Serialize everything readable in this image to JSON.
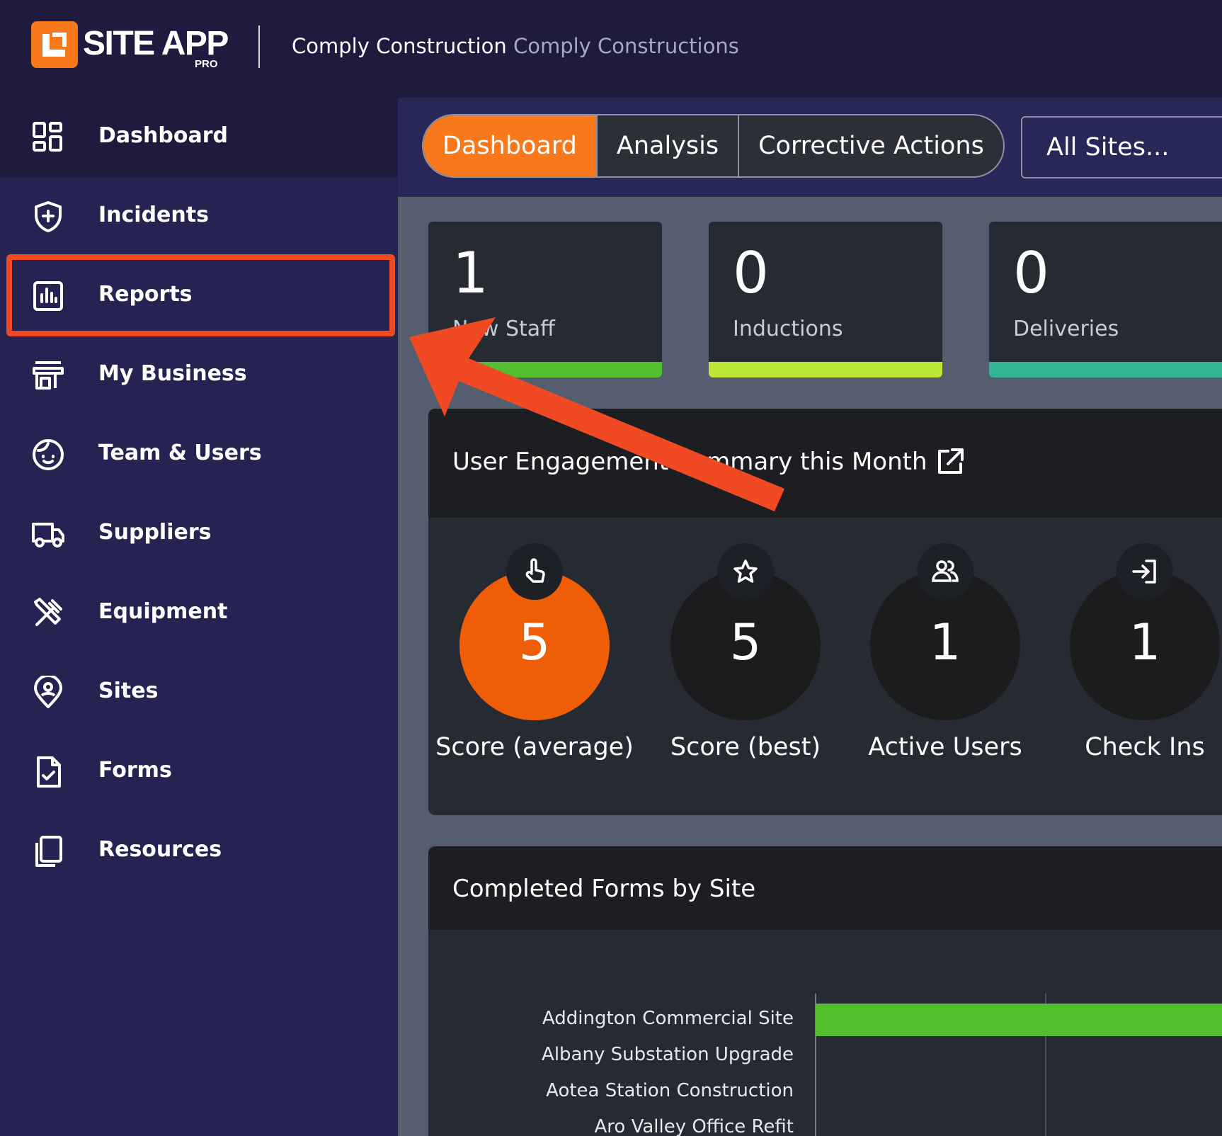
{
  "brand": {
    "name": "SITE APP",
    "tier": "PRO",
    "accent": "#f7791c"
  },
  "company": {
    "name": "Comply Construction",
    "sub": "Comply Constructions"
  },
  "sidebar": {
    "items": [
      {
        "label": "Dashboard",
        "icon": "dashboard-grid-icon",
        "active": true
      },
      {
        "label": "Incidents",
        "icon": "shield-plus-icon"
      },
      {
        "label": "Reports",
        "icon": "report-chart-icon"
      },
      {
        "label": "My Business",
        "icon": "storefront-icon"
      },
      {
        "label": "Team & Users",
        "icon": "face-icon"
      },
      {
        "label": "Suppliers",
        "icon": "truck-icon"
      },
      {
        "label": "Equipment",
        "icon": "tools-icon"
      },
      {
        "label": "Sites",
        "icon": "location-pin-icon"
      },
      {
        "label": "Forms",
        "icon": "form-check-icon"
      },
      {
        "label": "Resources",
        "icon": "copy-documents-icon"
      }
    ]
  },
  "tabs": [
    {
      "label": "Dashboard",
      "active": true
    },
    {
      "label": "Analysis"
    },
    {
      "label": "Corrective Actions"
    }
  ],
  "site_filter": {
    "value": "All Sites..."
  },
  "stats": [
    {
      "value": "1",
      "label": "New Staff",
      "color": "#54be2e"
    },
    {
      "value": "0",
      "label": "Inductions",
      "color": "#bde736"
    },
    {
      "value": "0",
      "label": "Deliveries",
      "color": "#34b594"
    }
  ],
  "engagement": {
    "title": "User Engagement Summary this Month",
    "items": [
      {
        "value": "5",
        "label": "Score (average)",
        "icon": "tap-icon",
        "color": "#f05d07"
      },
      {
        "value": "5",
        "label": "Score (best)",
        "icon": "star-icon"
      },
      {
        "value": "1",
        "label": "Active Users",
        "icon": "users-icon"
      },
      {
        "value": "1",
        "label": "Check Ins",
        "icon": "check-in-icon"
      }
    ]
  },
  "forms_panel": {
    "title": "Completed Forms by Site"
  },
  "chart_data": {
    "type": "bar",
    "orientation": "horizontal",
    "title": "Completed Forms by Site",
    "categories": [
      "Addington Commercial Site",
      "Albany Substation Upgrade",
      "Aotea Station Construction",
      "Aro Valley Office Refit"
    ],
    "values": [
      1,
      0,
      0,
      0
    ],
    "color": "#54be2e"
  },
  "annotation": {
    "color": "#f04a24",
    "target": "Reports"
  }
}
